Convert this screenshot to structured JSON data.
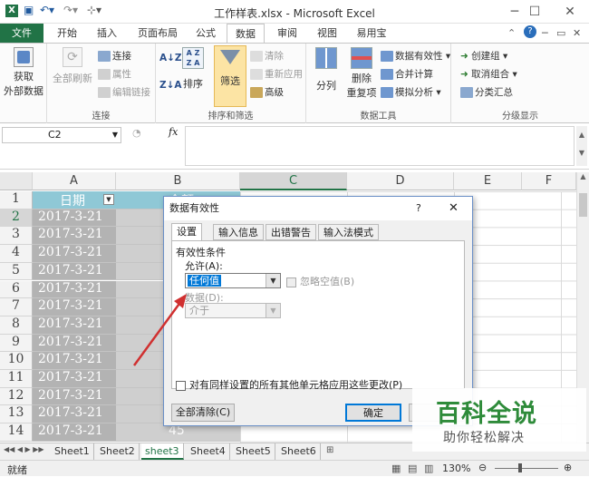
{
  "window": {
    "title": "工作样表.xlsx - Microsoft Excel"
  },
  "ribbon_tabs": [
    "文件",
    "开始",
    "插入",
    "页面布局",
    "公式",
    "数据",
    "审阅",
    "视图",
    "易用宝"
  ],
  "active_tab": "数据",
  "ribbon": {
    "get_data": {
      "line1": "获取",
      "line2": "外部数据"
    },
    "connections": {
      "refresh_all": "全部刷新",
      "connections": "连接",
      "properties": "属性",
      "edit_links": "编辑链接",
      "group": "连接"
    },
    "sort_filter": {
      "sort": "排序",
      "filter": "筛选",
      "clear": "清除",
      "reapply": "重新应用",
      "advanced": "高级",
      "group": "排序和筛选",
      "az": "A Z",
      "za": "Z A"
    },
    "data_tools": {
      "text_to_columns": "分列",
      "remove_dup_1": "删除",
      "remove_dup_2": "重复项",
      "validation": "数据有效性",
      "consolidate": "合并计算",
      "what_if": "模拟分析",
      "group": "数据工具"
    },
    "outline": {
      "group_btn": "创建组",
      "ungroup": "取消组合",
      "subtotal": "分类汇总",
      "group": "分级显示"
    }
  },
  "formula_bar": {
    "name_box": "C2",
    "fx": "fx"
  },
  "columns": [
    "A",
    "B",
    "C",
    "D",
    "E",
    "F"
  ],
  "selected_column": "C",
  "rows": [
    {
      "n": "1",
      "a": "日期",
      "b": "金额"
    },
    {
      "n": "2",
      "a": "2017-3-21",
      "b": ""
    },
    {
      "n": "3",
      "a": "2017-3-21",
      "b": ""
    },
    {
      "n": "4",
      "a": "2017-3-21",
      "b": ""
    },
    {
      "n": "5",
      "a": "2017-3-21",
      "b": ""
    },
    {
      "n": "6",
      "a": "2017-3-21",
      "b": ""
    },
    {
      "n": "7",
      "a": "2017-3-21",
      "b": ""
    },
    {
      "n": "8",
      "a": "2017-3-21",
      "b": ""
    },
    {
      "n": "9",
      "a": "2017-3-21",
      "b": ""
    },
    {
      "n": "10",
      "a": "2017-3-21",
      "b": ""
    },
    {
      "n": "11",
      "a": "2017-3-21",
      "b": ""
    },
    {
      "n": "12",
      "a": "2017-3-21",
      "b": ""
    },
    {
      "n": "13",
      "a": "2017-3-21",
      "b": ""
    },
    {
      "n": "14",
      "a": "2017-3-21",
      "b": "45"
    }
  ],
  "sheets": [
    "Sheet1",
    "Sheet2",
    "sheet3",
    "Sheet4",
    "Sheet5",
    "Sheet6"
  ],
  "active_sheet": "sheet3",
  "status": {
    "mode": "就绪",
    "zoom": "130%"
  },
  "dialog": {
    "title": "数据有效性",
    "help": "?",
    "close": "✕",
    "tabs": [
      "设置",
      "输入信息",
      "出错警告",
      "输入法模式"
    ],
    "criteria_label": "有效性条件",
    "allow_label": "允许(A):",
    "allow_value": "任何值",
    "ignore_blank": "忽略空值(B)",
    "data_label": "数据(D):",
    "data_value": "介于",
    "apply_all": "对有同样设置的所有其他单元格应用这些更改(P)",
    "clear_all": "全部清除(C)",
    "ok": "确定"
  },
  "watermark": {
    "line1": "百科全说",
    "line2": "助你轻松解决"
  },
  "colors": {
    "excel_green": "#217346",
    "arrow_red": "#d03030"
  }
}
